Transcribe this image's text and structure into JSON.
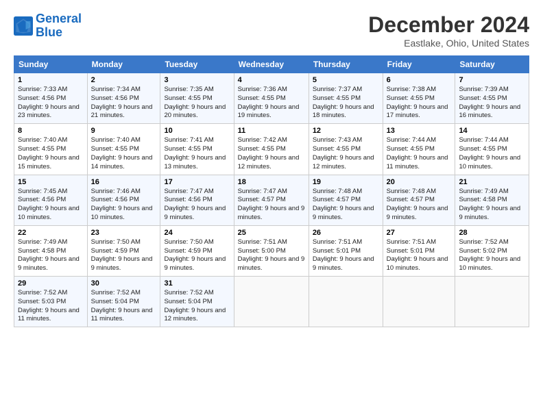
{
  "header": {
    "logo_line1": "General",
    "logo_line2": "Blue",
    "title": "December 2024",
    "location": "Eastlake, Ohio, United States"
  },
  "weekdays": [
    "Sunday",
    "Monday",
    "Tuesday",
    "Wednesday",
    "Thursday",
    "Friday",
    "Saturday"
  ],
  "weeks": [
    [
      {
        "day": "1",
        "sunrise": "Sunrise: 7:33 AM",
        "sunset": "Sunset: 4:56 PM",
        "daylight": "Daylight: 9 hours and 23 minutes."
      },
      {
        "day": "2",
        "sunrise": "Sunrise: 7:34 AM",
        "sunset": "Sunset: 4:56 PM",
        "daylight": "Daylight: 9 hours and 21 minutes."
      },
      {
        "day": "3",
        "sunrise": "Sunrise: 7:35 AM",
        "sunset": "Sunset: 4:55 PM",
        "daylight": "Daylight: 9 hours and 20 minutes."
      },
      {
        "day": "4",
        "sunrise": "Sunrise: 7:36 AM",
        "sunset": "Sunset: 4:55 PM",
        "daylight": "Daylight: 9 hours and 19 minutes."
      },
      {
        "day": "5",
        "sunrise": "Sunrise: 7:37 AM",
        "sunset": "Sunset: 4:55 PM",
        "daylight": "Daylight: 9 hours and 18 minutes."
      },
      {
        "day": "6",
        "sunrise": "Sunrise: 7:38 AM",
        "sunset": "Sunset: 4:55 PM",
        "daylight": "Daylight: 9 hours and 17 minutes."
      },
      {
        "day": "7",
        "sunrise": "Sunrise: 7:39 AM",
        "sunset": "Sunset: 4:55 PM",
        "daylight": "Daylight: 9 hours and 16 minutes."
      }
    ],
    [
      {
        "day": "8",
        "sunrise": "Sunrise: 7:40 AM",
        "sunset": "Sunset: 4:55 PM",
        "daylight": "Daylight: 9 hours and 15 minutes."
      },
      {
        "day": "9",
        "sunrise": "Sunrise: 7:40 AM",
        "sunset": "Sunset: 4:55 PM",
        "daylight": "Daylight: 9 hours and 14 minutes."
      },
      {
        "day": "10",
        "sunrise": "Sunrise: 7:41 AM",
        "sunset": "Sunset: 4:55 PM",
        "daylight": "Daylight: 9 hours and 13 minutes."
      },
      {
        "day": "11",
        "sunrise": "Sunrise: 7:42 AM",
        "sunset": "Sunset: 4:55 PM",
        "daylight": "Daylight: 9 hours and 12 minutes."
      },
      {
        "day": "12",
        "sunrise": "Sunrise: 7:43 AM",
        "sunset": "Sunset: 4:55 PM",
        "daylight": "Daylight: 9 hours and 12 minutes."
      },
      {
        "day": "13",
        "sunrise": "Sunrise: 7:44 AM",
        "sunset": "Sunset: 4:55 PM",
        "daylight": "Daylight: 9 hours and 11 minutes."
      },
      {
        "day": "14",
        "sunrise": "Sunrise: 7:44 AM",
        "sunset": "Sunset: 4:55 PM",
        "daylight": "Daylight: 9 hours and 10 minutes."
      }
    ],
    [
      {
        "day": "15",
        "sunrise": "Sunrise: 7:45 AM",
        "sunset": "Sunset: 4:56 PM",
        "daylight": "Daylight: 9 hours and 10 minutes."
      },
      {
        "day": "16",
        "sunrise": "Sunrise: 7:46 AM",
        "sunset": "Sunset: 4:56 PM",
        "daylight": "Daylight: 9 hours and 10 minutes."
      },
      {
        "day": "17",
        "sunrise": "Sunrise: 7:47 AM",
        "sunset": "Sunset: 4:56 PM",
        "daylight": "Daylight: 9 hours and 9 minutes."
      },
      {
        "day": "18",
        "sunrise": "Sunrise: 7:47 AM",
        "sunset": "Sunset: 4:57 PM",
        "daylight": "Daylight: 9 hours and 9 minutes."
      },
      {
        "day": "19",
        "sunrise": "Sunrise: 7:48 AM",
        "sunset": "Sunset: 4:57 PM",
        "daylight": "Daylight: 9 hours and 9 minutes."
      },
      {
        "day": "20",
        "sunrise": "Sunrise: 7:48 AM",
        "sunset": "Sunset: 4:57 PM",
        "daylight": "Daylight: 9 hours and 9 minutes."
      },
      {
        "day": "21",
        "sunrise": "Sunrise: 7:49 AM",
        "sunset": "Sunset: 4:58 PM",
        "daylight": "Daylight: 9 hours and 9 minutes."
      }
    ],
    [
      {
        "day": "22",
        "sunrise": "Sunrise: 7:49 AM",
        "sunset": "Sunset: 4:58 PM",
        "daylight": "Daylight: 9 hours and 9 minutes."
      },
      {
        "day": "23",
        "sunrise": "Sunrise: 7:50 AM",
        "sunset": "Sunset: 4:59 PM",
        "daylight": "Daylight: 9 hours and 9 minutes."
      },
      {
        "day": "24",
        "sunrise": "Sunrise: 7:50 AM",
        "sunset": "Sunset: 4:59 PM",
        "daylight": "Daylight: 9 hours and 9 minutes."
      },
      {
        "day": "25",
        "sunrise": "Sunrise: 7:51 AM",
        "sunset": "Sunset: 5:00 PM",
        "daylight": "Daylight: 9 hours and 9 minutes."
      },
      {
        "day": "26",
        "sunrise": "Sunrise: 7:51 AM",
        "sunset": "Sunset: 5:01 PM",
        "daylight": "Daylight: 9 hours and 9 minutes."
      },
      {
        "day": "27",
        "sunrise": "Sunrise: 7:51 AM",
        "sunset": "Sunset: 5:01 PM",
        "daylight": "Daylight: 9 hours and 10 minutes."
      },
      {
        "day": "28",
        "sunrise": "Sunrise: 7:52 AM",
        "sunset": "Sunset: 5:02 PM",
        "daylight": "Daylight: 9 hours and 10 minutes."
      }
    ],
    [
      {
        "day": "29",
        "sunrise": "Sunrise: 7:52 AM",
        "sunset": "Sunset: 5:03 PM",
        "daylight": "Daylight: 9 hours and 11 minutes."
      },
      {
        "day": "30",
        "sunrise": "Sunrise: 7:52 AM",
        "sunset": "Sunset: 5:04 PM",
        "daylight": "Daylight: 9 hours and 11 minutes."
      },
      {
        "day": "31",
        "sunrise": "Sunrise: 7:52 AM",
        "sunset": "Sunset: 5:04 PM",
        "daylight": "Daylight: 9 hours and 12 minutes."
      },
      null,
      null,
      null,
      null
    ]
  ]
}
